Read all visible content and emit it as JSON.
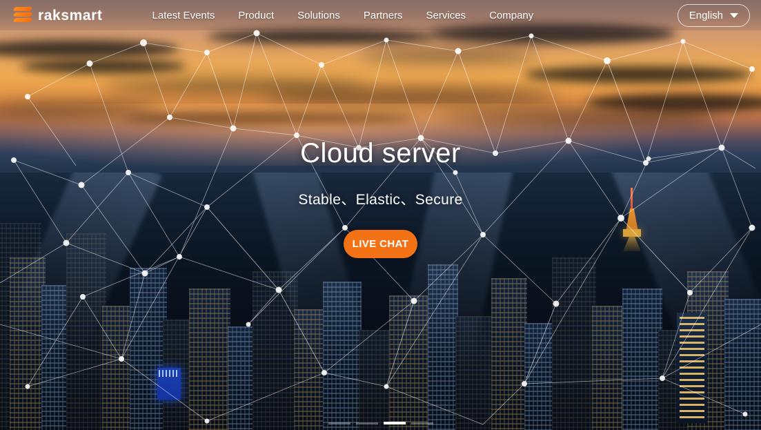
{
  "site": {
    "brand": "raksmart",
    "brand_icon": "raksmart-stack-logo-icon",
    "accent_color": "#f47216"
  },
  "header": {
    "nav": [
      {
        "label": "Latest Events",
        "name": "nav-item-latest-events"
      },
      {
        "label": "Product",
        "name": "nav-item-product"
      },
      {
        "label": "Solutions",
        "name": "nav-item-solutions"
      },
      {
        "label": "Partners",
        "name": "nav-item-partners"
      },
      {
        "label": "Services",
        "name": "nav-item-services"
      },
      {
        "label": "Company",
        "name": "nav-item-company"
      }
    ],
    "language": {
      "selected": "English",
      "chevron_icon": "chevron-down-icon"
    }
  },
  "hero": {
    "title": "Cloud server",
    "subtitle": "Stable、Elastic、Secure",
    "cta_label": "LIVE CHAT"
  },
  "carousel": {
    "slide_count": 4,
    "active_index": 2
  }
}
